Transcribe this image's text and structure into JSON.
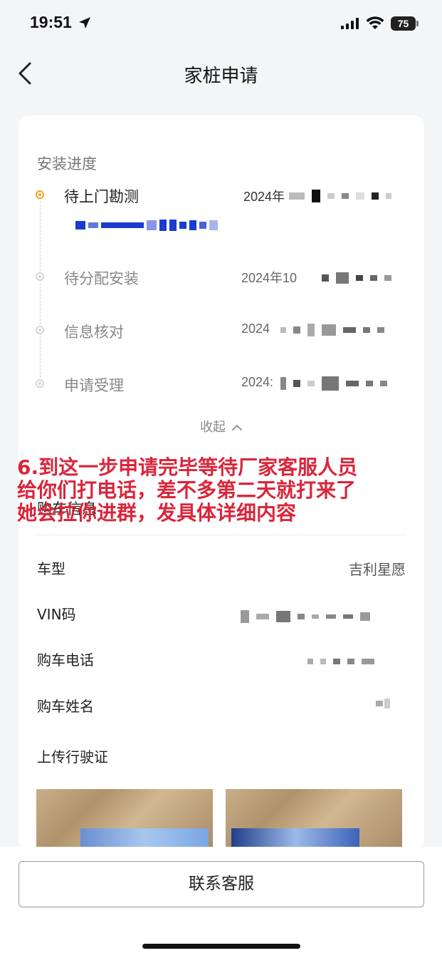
{
  "status_bar": {
    "time": "19:51",
    "battery": "75"
  },
  "nav": {
    "title": "家桩申请"
  },
  "progress": {
    "section_title": "安装进度",
    "steps": [
      {
        "label": "待上门勘测",
        "date": "2024年",
        "status": "active"
      },
      {
        "label": "待分配安装",
        "date": "2024年10",
        "status": "done"
      },
      {
        "label": "信息核对",
        "date": "2024",
        "status": "done"
      },
      {
        "label": "申请受理",
        "date": "2024:",
        "status": "done"
      }
    ],
    "collapse_label": "收起"
  },
  "annotation": {
    "lines": [
      "6.到这一步申请完毕等待厂家客服人员",
      "给你们打电话，差不多第二天就打来了",
      "她会拉你进群，发具体详细内容"
    ]
  },
  "purchase": {
    "section_title": "购车信息",
    "fields": [
      {
        "label": "车型",
        "value": "吉利星愿"
      },
      {
        "label": "VIN码",
        "value": ""
      },
      {
        "label": "购车电话",
        "value": ""
      },
      {
        "label": "购车姓名",
        "value": ""
      }
    ],
    "upload_label": "上传行驶证"
  },
  "bottom": {
    "contact_button": "联系客服"
  },
  "colors": {
    "accent": "#f2a623",
    "annotation": "#d9263b",
    "background": "#f4f5f7"
  },
  "icons": [
    "location-arrow-icon",
    "signal-icon",
    "wifi-icon",
    "battery-icon",
    "back-icon",
    "chevron-up-icon"
  ]
}
